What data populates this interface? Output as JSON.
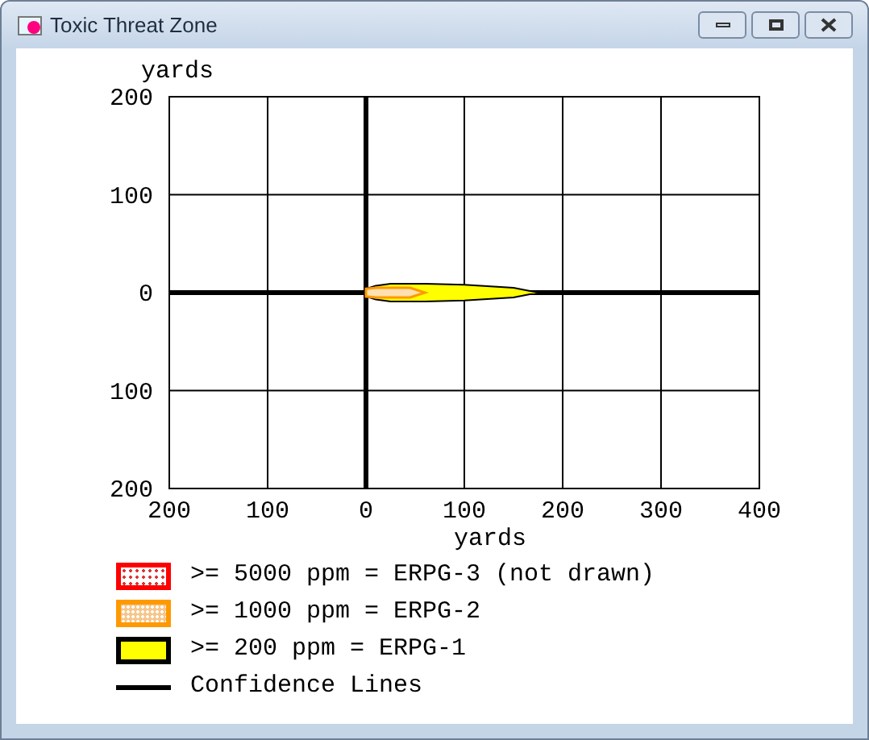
{
  "window": {
    "title": "Toxic Threat Zone"
  },
  "plot": {
    "chart_data": {
      "type": "area",
      "xlabel": "yards",
      "ylabel": "yards",
      "xlim": [
        -200,
        400
      ],
      "ylim": [
        -200,
        200
      ],
      "xticks": [
        {
          "value": -200,
          "label": "200"
        },
        {
          "value": -100,
          "label": "100"
        },
        {
          "value": 0,
          "label": "0"
        },
        {
          "value": 100,
          "label": "100"
        },
        {
          "value": 200,
          "label": "200"
        },
        {
          "value": 300,
          "label": "300"
        },
        {
          "value": 400,
          "label": "400"
        }
      ],
      "yticks": [
        {
          "value": 200,
          "label": "200"
        },
        {
          "value": 100,
          "label": "100"
        },
        {
          "value": 0,
          "label": "0"
        },
        {
          "value": -100,
          "label": "100"
        },
        {
          "value": -200,
          "label": "200"
        }
      ],
      "grid": true
    }
  },
  "legend": [
    {
      "kind": "dotted",
      "color": "#ff0000",
      "label": ">= 5000 ppm = ERPG-3 (not drawn)"
    },
    {
      "kind": "stippled",
      "color": "#ff9900",
      "label": ">= 1000 ppm = ERPG-2"
    },
    {
      "kind": "solid",
      "color": "#ffff00",
      "label": ">= 200 ppm = ERPG-1"
    },
    {
      "kind": "line",
      "color": "#000000",
      "label": "Confidence Lines"
    }
  ]
}
